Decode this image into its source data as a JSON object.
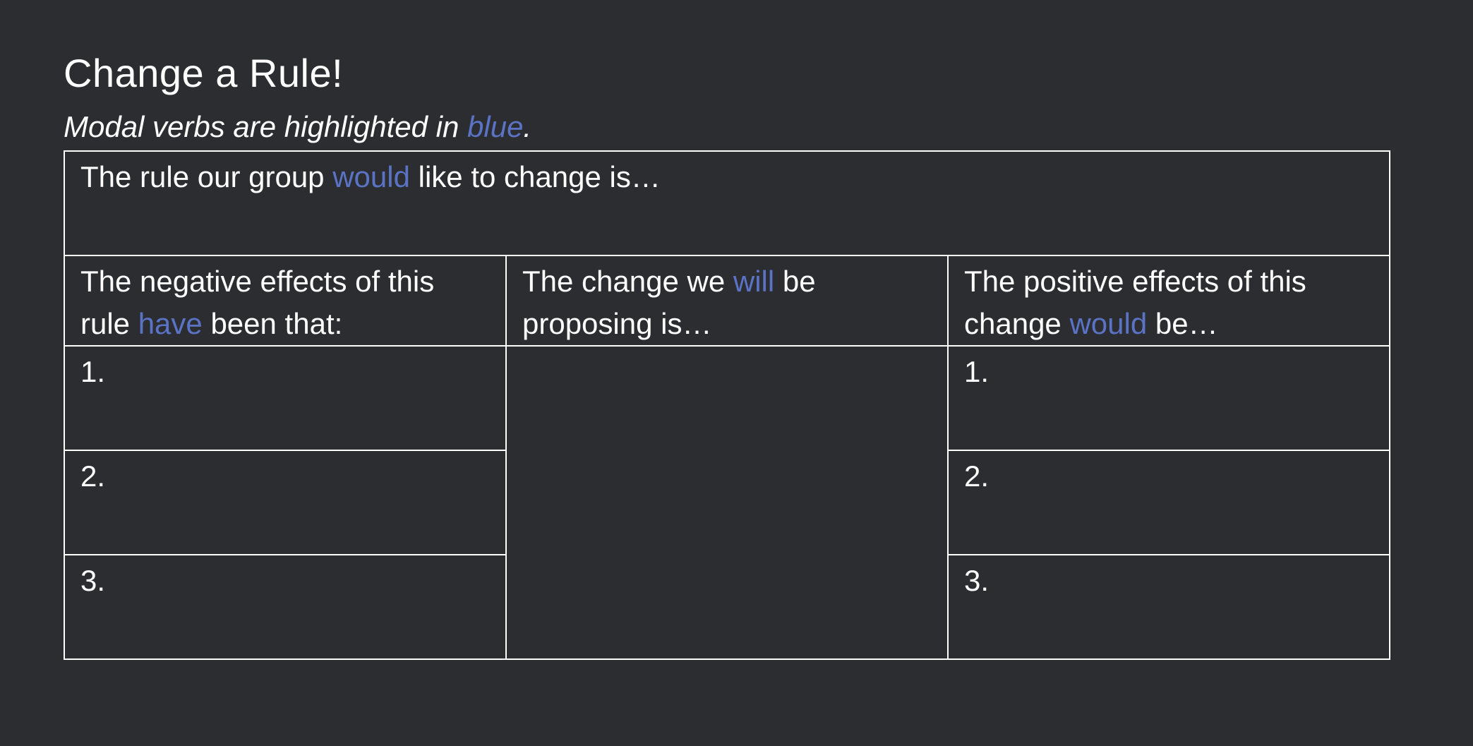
{
  "title": "Change a Rule!",
  "subtitle": {
    "before": "Modal verbs are highlighted in ",
    "highlight": "blue",
    "after": "."
  },
  "highlight_color": "#5b73c4",
  "background_color": "#2c2d31",
  "table": {
    "rule_row": {
      "before": "The rule our group ",
      "modal": "would",
      "after": " like to change is…"
    },
    "negative_header": {
      "before": "The negative effects of this rule ",
      "modal": "have",
      "after": " been that:"
    },
    "change_header": {
      "before": "The change we ",
      "modal": "will",
      "after": " be proposing is…"
    },
    "positive_header": {
      "before": "The positive effects of this change ",
      "modal": "would",
      "after": " be…"
    },
    "negative_items": [
      "1.",
      "2.",
      "3."
    ],
    "positive_items": [
      "1.",
      "2.",
      "3."
    ]
  }
}
